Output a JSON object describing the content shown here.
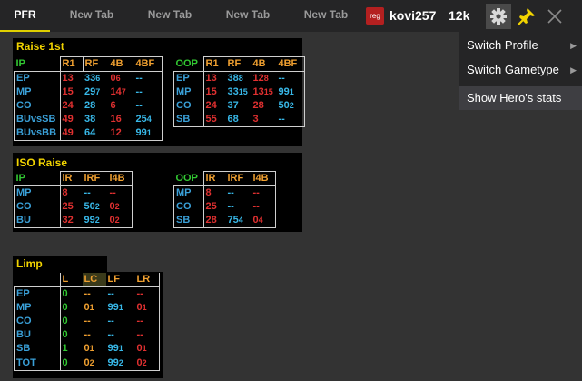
{
  "tabs": [
    {
      "label": "PFR",
      "active": true
    },
    {
      "label": "New Tab"
    },
    {
      "label": "New Tab"
    },
    {
      "label": "New Tab"
    },
    {
      "label": "New Tab"
    }
  ],
  "badge": "reg",
  "player": "kovi257",
  "hands": "12k",
  "icons": {
    "settings": "gear-icon",
    "pin": "pin-icon",
    "close": "close-icon"
  },
  "colors": {
    "title": "#f2d400",
    "position": "#3aa0d8",
    "header": "#f0a030",
    "red": "#e03030",
    "cyan": "#38b8e8",
    "green": "#32c832"
  },
  "menu": {
    "items": [
      {
        "label": "Switch Profile",
        "has_submenu": true
      },
      {
        "label": "Switch Gametype",
        "has_submenu": true
      },
      {
        "label": "Show Hero's stats",
        "has_submenu": false
      }
    ]
  },
  "raise_first": {
    "title": "Raise 1st",
    "ip": {
      "label": "IP",
      "headers": [
        "R1",
        "RF",
        "4B",
        "4BF"
      ],
      "rows": [
        {
          "pos": "EP",
          "cells": [
            [
              "13",
              ""
            ],
            [
              "33",
              "6"
            ],
            [
              "0",
              "6"
            ],
            [
              "--",
              ""
            ]
          ]
        },
        {
          "pos": "MP",
          "cells": [
            [
              "15",
              ""
            ],
            [
              "29",
              "7"
            ],
            [
              "14",
              "7"
            ],
            [
              "--",
              ""
            ]
          ]
        },
        {
          "pos": "CO",
          "cells": [
            [
              "24",
              ""
            ],
            [
              "28",
              ""
            ],
            [
              "6",
              ""
            ],
            [
              "--",
              ""
            ]
          ]
        },
        {
          "pos": "BUvsSB",
          "cells": [
            [
              "49",
              ""
            ],
            [
              "38",
              ""
            ],
            [
              "16",
              ""
            ],
            [
              "25",
              "4"
            ]
          ]
        },
        {
          "pos": "BUvsBB",
          "cells": [
            [
              "49",
              ""
            ],
            [
              "64",
              ""
            ],
            [
              "12",
              ""
            ],
            [
              "99",
              "1"
            ]
          ]
        }
      ]
    },
    "oop": {
      "label": "OOP",
      "headers": [
        "R1",
        "RF",
        "4B",
        "4BF"
      ],
      "rows": [
        {
          "pos": "EP",
          "cells": [
            [
              "13",
              ""
            ],
            [
              "38",
              "8"
            ],
            [
              "12",
              "8"
            ],
            [
              "--",
              ""
            ]
          ]
        },
        {
          "pos": "MP",
          "cells": [
            [
              "15",
              ""
            ],
            [
              "33",
              "15"
            ],
            [
              "13",
              "15"
            ],
            [
              "99",
              "1"
            ]
          ]
        },
        {
          "pos": "CO",
          "cells": [
            [
              "24",
              ""
            ],
            [
              "37",
              ""
            ],
            [
              "28",
              ""
            ],
            [
              "50",
              "2"
            ]
          ]
        },
        {
          "pos": "SB",
          "cells": [
            [
              "55",
              ""
            ],
            [
              "68",
              ""
            ],
            [
              "3",
              ""
            ],
            [
              "--",
              ""
            ]
          ]
        }
      ]
    }
  },
  "iso_raise": {
    "title": "ISO Raise",
    "ip": {
      "label": "IP",
      "headers": [
        "iR",
        "iRF",
        "i4B"
      ],
      "rows": [
        {
          "pos": "MP",
          "cells": [
            [
              "8",
              ""
            ],
            [
              "--",
              ""
            ],
            [
              "--",
              ""
            ]
          ]
        },
        {
          "pos": "CO",
          "cells": [
            [
              "25",
              ""
            ],
            [
              "50",
              "2"
            ],
            [
              "0",
              "2"
            ]
          ]
        },
        {
          "pos": "BU",
          "cells": [
            [
              "32",
              ""
            ],
            [
              "99",
              "2"
            ],
            [
              "0",
              "2"
            ]
          ]
        }
      ]
    },
    "oop": {
      "label": "OOP",
      "headers": [
        "iR",
        "iRF",
        "i4B"
      ],
      "rows": [
        {
          "pos": "MP",
          "cells": [
            [
              "8",
              ""
            ],
            [
              "--",
              ""
            ],
            [
              "--",
              ""
            ]
          ]
        },
        {
          "pos": "CO",
          "cells": [
            [
              "25",
              ""
            ],
            [
              "--",
              ""
            ],
            [
              "--",
              ""
            ]
          ]
        },
        {
          "pos": "SB",
          "cells": [
            [
              "28",
              ""
            ],
            [
              "75",
              "4"
            ],
            [
              "0",
              "4"
            ]
          ]
        }
      ]
    }
  },
  "limp": {
    "title": "Limp",
    "headers": [
      "L",
      "LC",
      "LF",
      "LR"
    ],
    "rows": [
      {
        "pos": "EP",
        "cells": [
          [
            "0",
            ""
          ],
          [
            "--",
            ""
          ],
          [
            "--",
            ""
          ],
          [
            "--",
            ""
          ]
        ]
      },
      {
        "pos": "MP",
        "cells": [
          [
            "0",
            ""
          ],
          [
            "0",
            "1"
          ],
          [
            "99",
            "1"
          ],
          [
            "0",
            "1"
          ]
        ]
      },
      {
        "pos": "CO",
        "cells": [
          [
            "0",
            ""
          ],
          [
            "--",
            ""
          ],
          [
            "--",
            ""
          ],
          [
            "--",
            ""
          ]
        ]
      },
      {
        "pos": "BU",
        "cells": [
          [
            "0",
            ""
          ],
          [
            "--",
            ""
          ],
          [
            "--",
            ""
          ],
          [
            "--",
            ""
          ]
        ]
      },
      {
        "pos": "SB",
        "cells": [
          [
            "1",
            ""
          ],
          [
            "0",
            "1"
          ],
          [
            "99",
            "1"
          ],
          [
            "0",
            "1"
          ]
        ]
      }
    ],
    "total": {
      "pos": "TOT",
      "cells": [
        [
          "0",
          ""
        ],
        [
          "0",
          "2"
        ],
        [
          "99",
          "2"
        ],
        [
          "0",
          "2"
        ]
      ]
    }
  }
}
